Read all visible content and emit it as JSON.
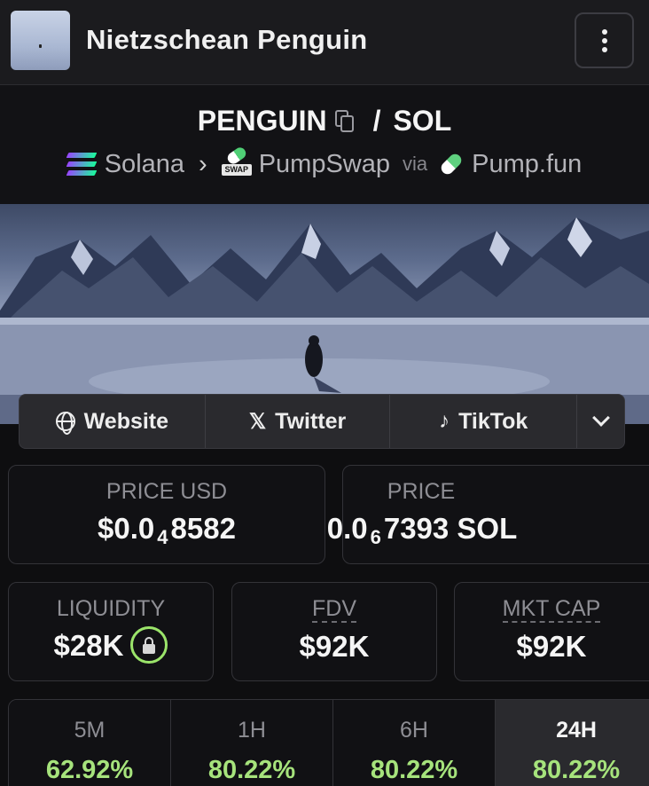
{
  "header": {
    "title": "Nietzschean Penguin",
    "menu_icon": "kebab-menu-icon"
  },
  "pair": {
    "base": "PENGUIN",
    "separator": "/",
    "quote": "SOL"
  },
  "route": {
    "chain": "Solana",
    "dex": "PumpSwap",
    "dex_badge": "SWAP",
    "via": "via",
    "launchpad": "Pump.fun"
  },
  "links": {
    "website": "Website",
    "twitter": "Twitter",
    "twitter_glyph": "𝕏",
    "tiktok": "TikTok",
    "tiktok_glyph": "♪"
  },
  "stats": {
    "price_usd": {
      "label": "PRICE USD",
      "prefix": "$0.0",
      "zeros": "4",
      "digits": "8582"
    },
    "price_sol": {
      "label": "PRICE",
      "prefix": "0.0",
      "zeros": "6",
      "digits": "7393 SOL"
    },
    "liquidity": {
      "label": "LIQUIDITY",
      "value": "$28K"
    },
    "fdv": {
      "label": "FDV",
      "value": "$92K"
    },
    "mkt_cap": {
      "label": "MKT CAP",
      "value": "$92K"
    }
  },
  "timeframes": [
    {
      "label": "5M",
      "change": "62.92%"
    },
    {
      "label": "1H",
      "change": "80.22%"
    },
    {
      "label": "6H",
      "change": "80.22%"
    },
    {
      "label": "24H",
      "change": "80.22%"
    }
  ],
  "active_timeframe": "24H",
  "colors": {
    "positive": "#a6e37c",
    "lock_ring": "#9be46a",
    "background": "#0e0e10"
  }
}
